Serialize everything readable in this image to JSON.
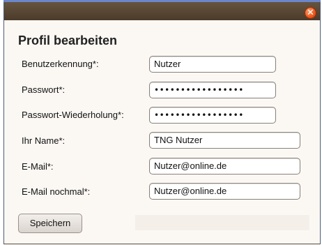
{
  "dialog": {
    "title": "Profil bearbeiten",
    "close_icon": "close-icon",
    "fields": [
      {
        "label": "Benutzerkennung*:",
        "value": "Nutzer",
        "type": "text"
      },
      {
        "label": "Passwort*:",
        "value": "•••••••••••••••••",
        "type": "password"
      },
      {
        "label": "Passwort-Wiederholung*:",
        "value": "•••••••••••••••••",
        "type": "password"
      },
      {
        "label": "Ihr Name*:",
        "value": "TNG Nutzer",
        "type": "text"
      },
      {
        "label": "E-Mail*:",
        "value": "Nutzer@online.de",
        "type": "text"
      },
      {
        "label": "E-Mail nochmal*:",
        "value": "Nutzer@online.de",
        "type": "text"
      }
    ],
    "save_label": "Speichern"
  },
  "colors": {
    "titlebar": "#5a4834",
    "close_button": "#e8521a",
    "background": "#fbf8f4"
  }
}
